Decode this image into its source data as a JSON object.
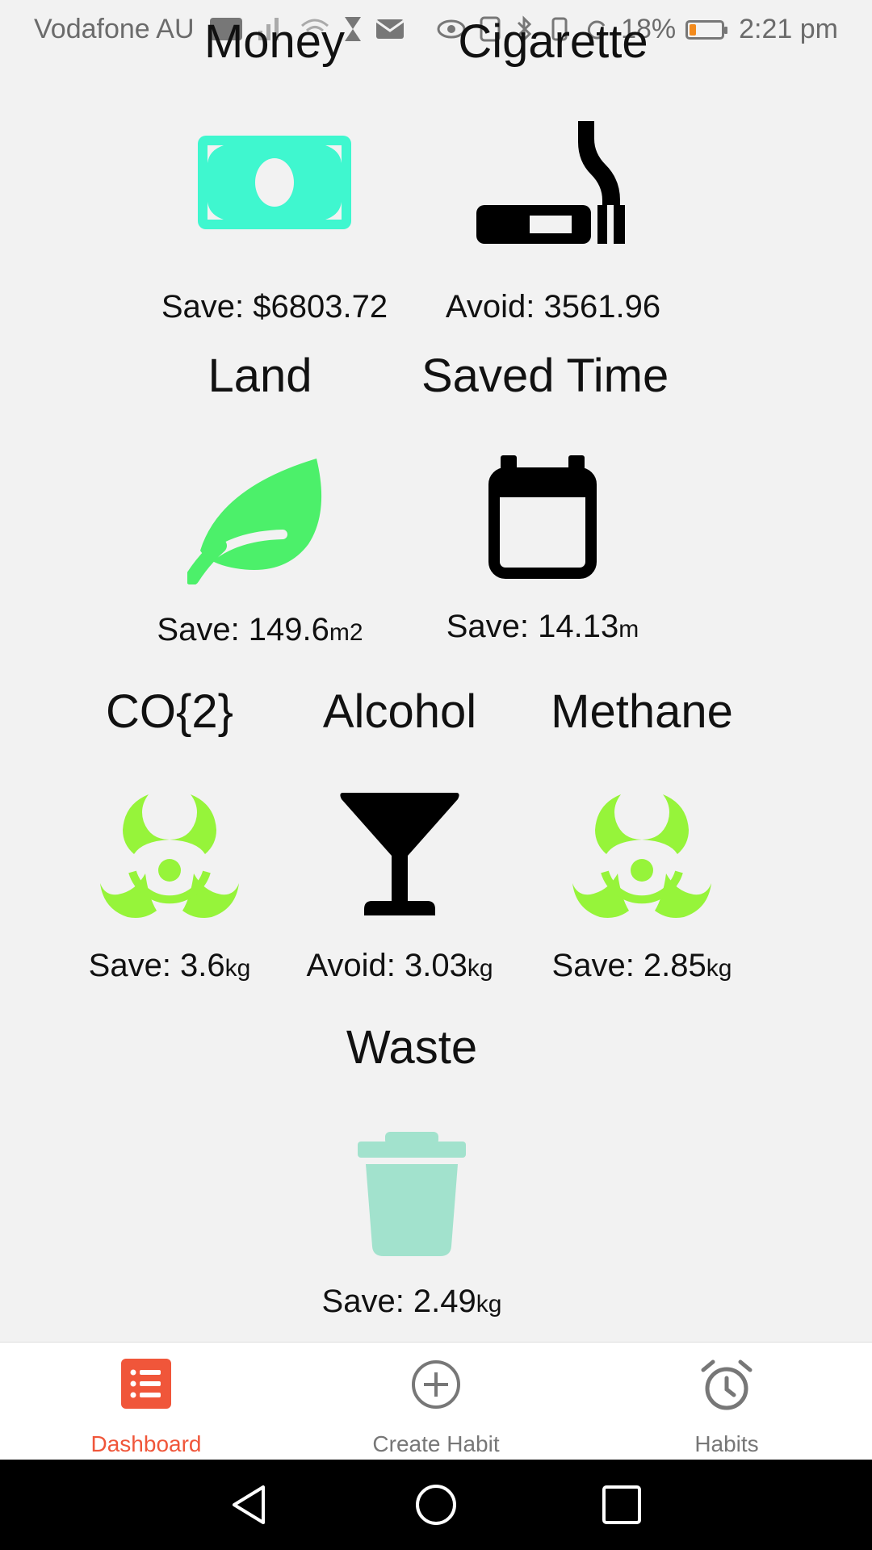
{
  "status_bar": {
    "carrier": "Vodafone AU",
    "battery": "18%",
    "time": "2:21 pm"
  },
  "tiles": {
    "money": {
      "title": "Money",
      "prefix": "Save: ",
      "value": "$6803.72",
      "unit": "",
      "icon": "banknote-icon",
      "color": "#3ff7cf"
    },
    "cigarette": {
      "title": "Cigarette",
      "prefix": "Avoid: ",
      "value": "3561.96",
      "unit": "",
      "icon": "cigarette-icon",
      "color": "#000000"
    },
    "land": {
      "title": "Land",
      "prefix": "Save: ",
      "value": "149.6",
      "unit": "m2",
      "icon": "leaf-icon",
      "color": "#4cf06a"
    },
    "saved_time": {
      "title": "Saved Time",
      "prefix": "Save: ",
      "value": "14.13",
      "unit": "m",
      "icon": "calendar-icon",
      "color": "#000000"
    },
    "co2": {
      "title": "CO{2}",
      "prefix": "Save: ",
      "value": "3.6",
      "unit": "kg",
      "icon": "biohazard-icon",
      "color": "#96f43a"
    },
    "alcohol": {
      "title": "Alcohol",
      "prefix": "Avoid: ",
      "value": "3.03",
      "unit": "kg",
      "icon": "cocktail-glass-icon",
      "color": "#000000"
    },
    "methane": {
      "title": "Methane",
      "prefix": "Save: ",
      "value": "2.85",
      "unit": "kg",
      "icon": "biohazard-icon",
      "color": "#96f43a"
    },
    "waste": {
      "title": "Waste",
      "prefix": "Save: ",
      "value": "2.49",
      "unit": "kg",
      "icon": "trash-can-icon",
      "color": "#a2e2cd"
    }
  },
  "bottom_nav": {
    "items": [
      {
        "label": "Dashboard",
        "icon": "list-icon",
        "active": true
      },
      {
        "label": "Create Habit",
        "icon": "add-circle-icon",
        "active": false
      },
      {
        "label": "Habits",
        "icon": "alarm-clock-icon",
        "active": false
      }
    ],
    "accent": "#f0563a"
  },
  "system_nav": {
    "icons": [
      "back-icon",
      "home-icon",
      "recents-icon"
    ]
  }
}
